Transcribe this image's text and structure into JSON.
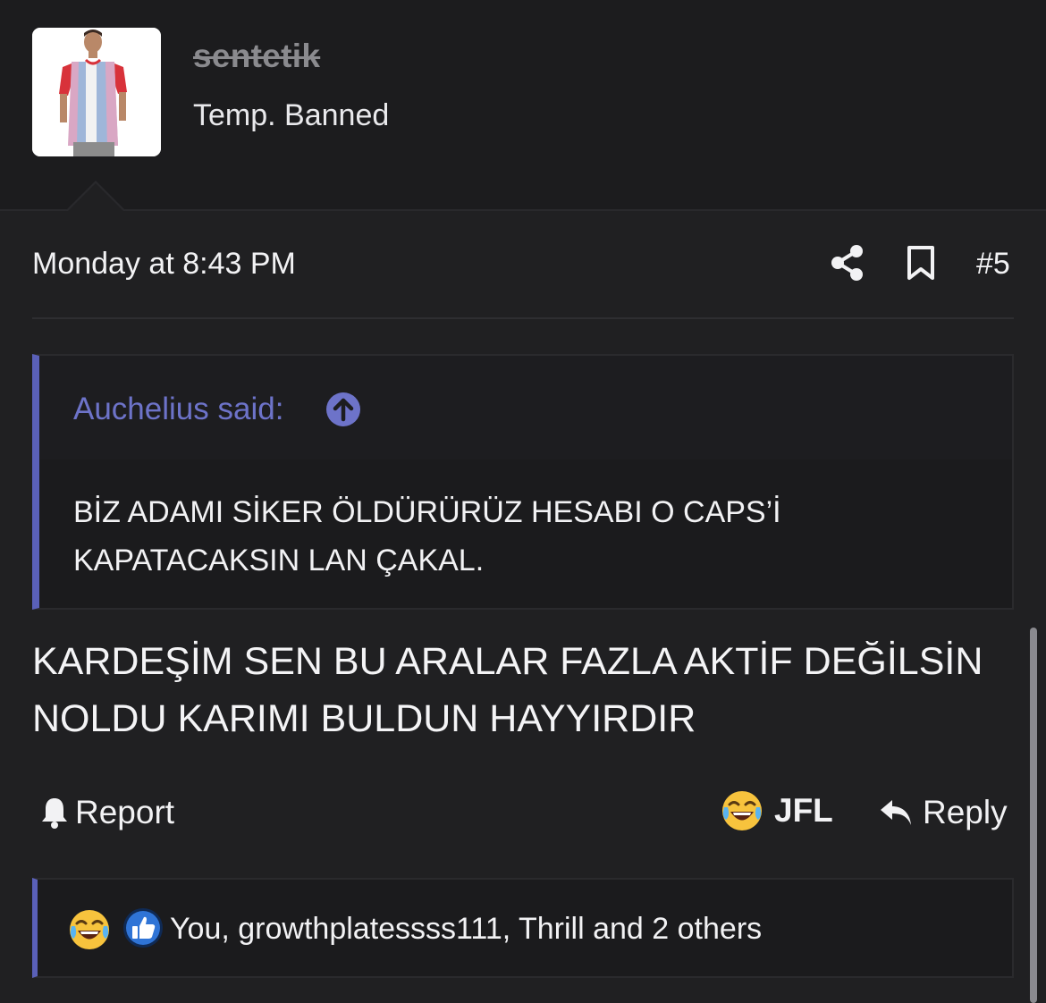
{
  "user": {
    "username": "sentetik",
    "title": "Temp. Banned"
  },
  "post": {
    "date": "Monday at 8:43 PM",
    "number": "#5",
    "icons": [
      "share-icon",
      "bookmark-icon"
    ]
  },
  "quote": {
    "author_label": "Auchelius said:",
    "jump_icon": "arrow-up-circle-icon",
    "text": "BİZ ADAMI SİKER ÖLDÜRÜRÜZ HESABI O CAPS’İ KAPATACAKSIN LAN ÇAKAL."
  },
  "message": {
    "text": "KARDEŞİM SEN BU ARALAR FAZLA AKTİF DEĞİLSİN NOLDU KARIMI BULDUN HAYYIRDIR"
  },
  "actions": {
    "report_label": "Report",
    "react_label": "JFL",
    "reply_label": "Reply"
  },
  "reactions": {
    "summary": "You, growthplatessss111, Thrill and 2 others",
    "icons": [
      "laughing-crying-emoji",
      "thumbs-up-icon"
    ]
  },
  "colors": {
    "background": "#202022",
    "header_background": "#1c1c1e",
    "accent": "#5a60b8",
    "quote_author": "#6d73c9",
    "like_blue": "#2f74d6"
  }
}
